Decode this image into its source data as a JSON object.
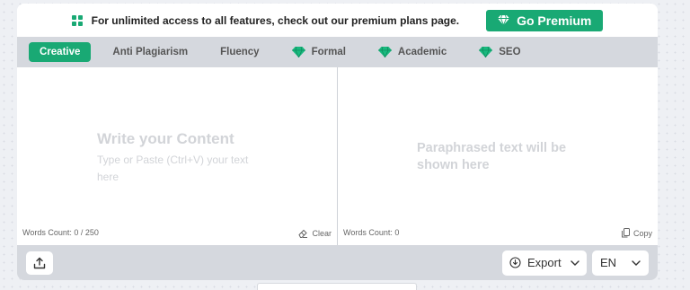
{
  "colors": {
    "accent": "#19a974",
    "toolbar_bg": "#d5d8de",
    "placeholder": "#d2d4d8"
  },
  "promo": {
    "text": "For unlimited access to all features, check out our premium plans page.",
    "button_label": "Go Premium",
    "icon": "grid-icon"
  },
  "tabs": [
    {
      "label": "Creative",
      "active": true,
      "premium": false
    },
    {
      "label": "Anti Plagiarism",
      "active": false,
      "premium": false
    },
    {
      "label": "Fluency",
      "active": false,
      "premium": false
    },
    {
      "label": "Formal",
      "active": false,
      "premium": true
    },
    {
      "label": "Academic",
      "active": false,
      "premium": true
    },
    {
      "label": "SEO",
      "active": false,
      "premium": true
    }
  ],
  "input": {
    "placeholder_title": "Write your Content",
    "placeholder_sub": "Type or Paste (Ctrl+V) your text here",
    "count": "Words Count: 0 / 250",
    "clear_label": "Clear"
  },
  "output": {
    "placeholder": "Paraphrased text will be shown here",
    "count": "Words Count: 0",
    "copy_label": "Copy"
  },
  "footer": {
    "export_label": "Export",
    "language": "EN",
    "upload_icon": "upload-icon"
  }
}
